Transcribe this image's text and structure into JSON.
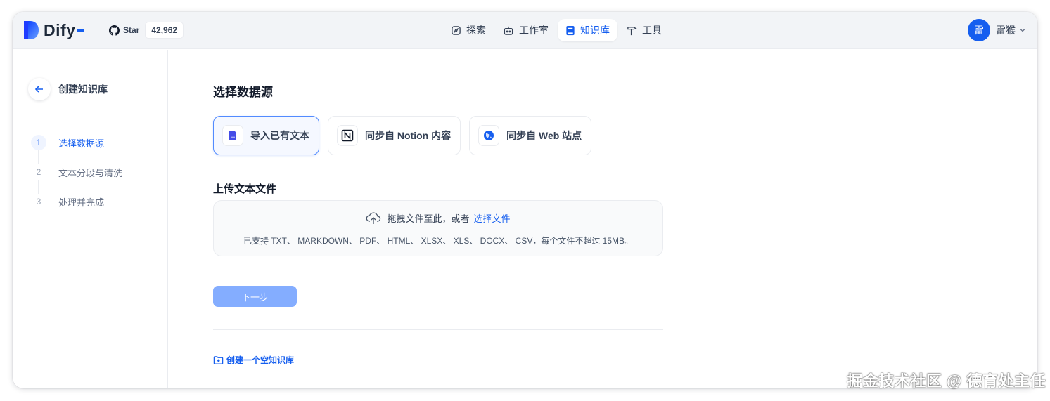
{
  "header": {
    "app_name": "Dify",
    "github": {
      "star_label": "Star",
      "star_count": "42,962"
    },
    "nav": [
      {
        "label": "探索",
        "icon": "explore-icon"
      },
      {
        "label": "工作室",
        "icon": "robot-icon"
      },
      {
        "label": "知识库",
        "icon": "book-icon",
        "active": true
      },
      {
        "label": "工具",
        "icon": "hammer-icon"
      }
    ],
    "user": {
      "avatar_text": "雷",
      "name": "雷猴"
    }
  },
  "sidebar": {
    "title": "创建知识库",
    "steps": [
      {
        "num": "1",
        "label": "选择数据源",
        "active": true
      },
      {
        "num": "2",
        "label": "文本分段与清洗"
      },
      {
        "num": "3",
        "label": "处理并完成"
      }
    ]
  },
  "main": {
    "section_title": "选择数据源",
    "sources": [
      {
        "label": "导入已有文本",
        "icon": "file-icon",
        "active": true
      },
      {
        "label": "同步自 Notion 内容",
        "icon": "notion-icon"
      },
      {
        "label": "同步自 Web 站点",
        "icon": "web-icon"
      }
    ],
    "upload_title": "上传文本文件",
    "dropzone": {
      "prompt": "拖拽文件至此，或者",
      "link": "选择文件",
      "hint": "已支持 TXT、 MARKDOWN、 PDF、 HTML、 XLSX、 XLS、 DOCX、 CSV，每个文件不超过 15MB。"
    },
    "next_label": "下一步",
    "create_empty_label": "创建一个空知识库"
  },
  "watermark": "掘金技术社区 @ 德育处主任",
  "colors": {
    "accent": "#155eef",
    "next_button": "#84adff"
  }
}
